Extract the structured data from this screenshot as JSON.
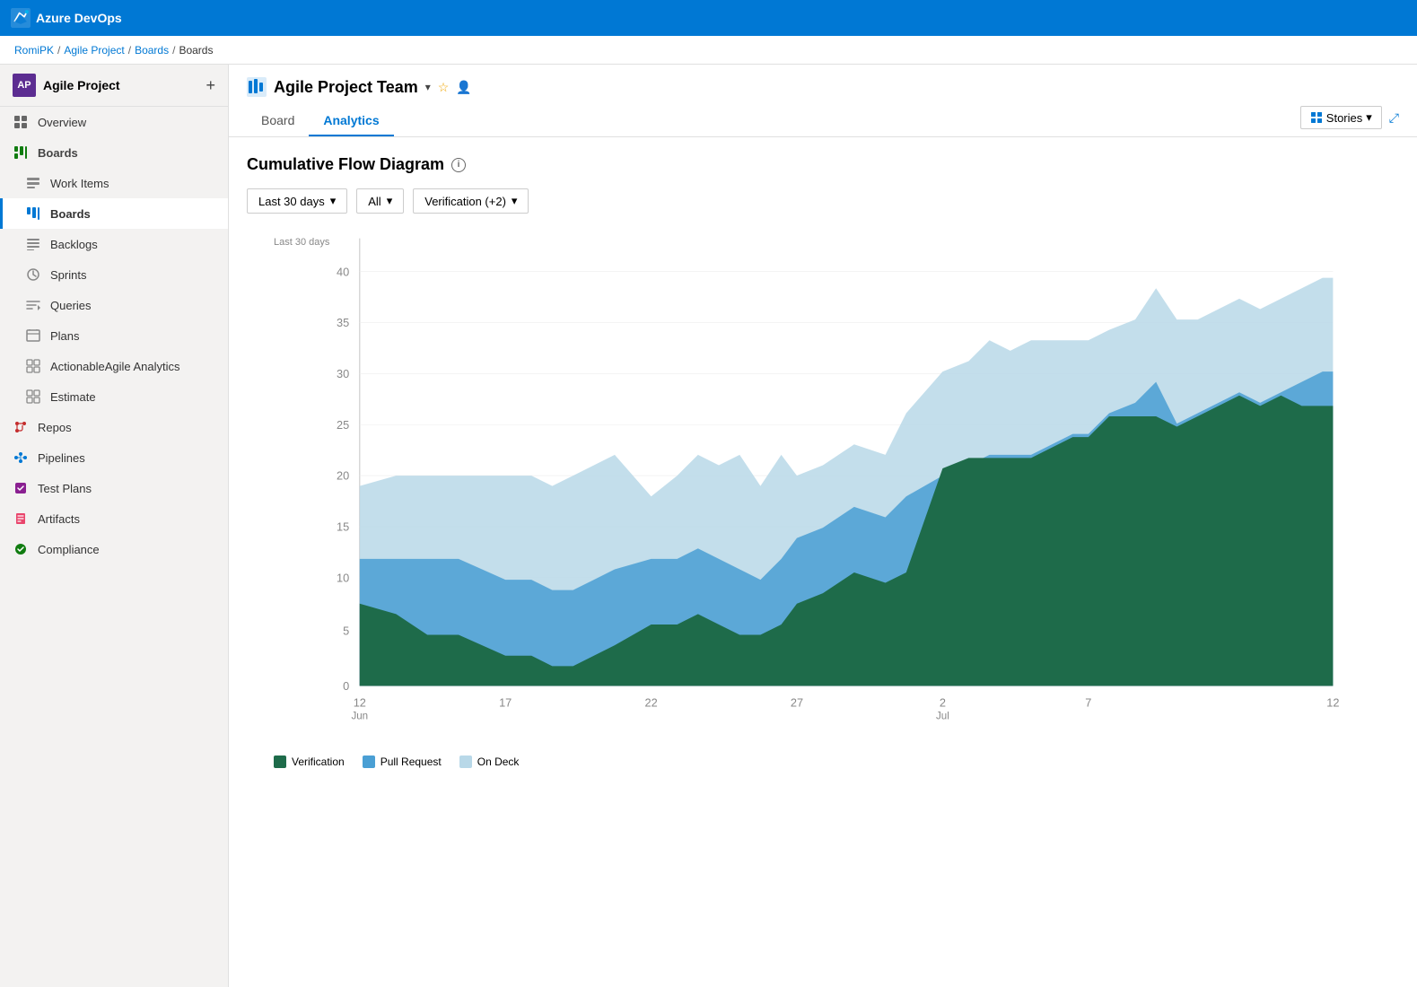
{
  "app": {
    "title": "Azure DevOps",
    "logo_color": "#0078d4"
  },
  "breadcrumb": {
    "items": [
      "RomiPK",
      "Agile Project",
      "Boards",
      "Boards"
    ]
  },
  "sidebar": {
    "project_name": "Agile Project",
    "avatar_text": "AP",
    "nav_items": [
      {
        "id": "overview",
        "label": "Overview",
        "icon": "overview"
      },
      {
        "id": "boards",
        "label": "Boards",
        "icon": "boards",
        "section": true
      },
      {
        "id": "work-items",
        "label": "Work Items",
        "icon": "work-items"
      },
      {
        "id": "boards2",
        "label": "Boards",
        "icon": "boards2",
        "active": true
      },
      {
        "id": "backlogs",
        "label": "Backlogs",
        "icon": "backlogs"
      },
      {
        "id": "sprints",
        "label": "Sprints",
        "icon": "sprints"
      },
      {
        "id": "queries",
        "label": "Queries",
        "icon": "queries"
      },
      {
        "id": "plans",
        "label": "Plans",
        "icon": "plans"
      },
      {
        "id": "actionable",
        "label": "ActionableAgile Analytics",
        "icon": "analytics"
      },
      {
        "id": "estimate",
        "label": "Estimate",
        "icon": "estimate"
      },
      {
        "id": "repos",
        "label": "Repos",
        "icon": "repos"
      },
      {
        "id": "pipelines",
        "label": "Pipelines",
        "icon": "pipelines"
      },
      {
        "id": "test-plans",
        "label": "Test Plans",
        "icon": "test-plans"
      },
      {
        "id": "artifacts",
        "label": "Artifacts",
        "icon": "artifacts"
      },
      {
        "id": "compliance",
        "label": "Compliance",
        "icon": "compliance"
      }
    ]
  },
  "content": {
    "team_title": "Agile Project Team",
    "tabs": [
      {
        "id": "board",
        "label": "Board",
        "active": false
      },
      {
        "id": "analytics",
        "label": "Analytics",
        "active": true
      }
    ],
    "toolbar": {
      "stories_label": "Stories",
      "expand_label": "⤢"
    },
    "chart": {
      "title": "Cumulative Flow Diagram",
      "label_period": "Last 30 days",
      "filters": [
        {
          "id": "period",
          "value": "Last 30 days"
        },
        {
          "id": "type",
          "value": "All"
        },
        {
          "id": "stages",
          "value": "Verification (+2)"
        }
      ],
      "x_labels": [
        "12\nJun",
        "17",
        "22",
        "27",
        "2\nJul",
        "7",
        "12"
      ],
      "y_labels": [
        "0",
        "5",
        "10",
        "15",
        "20",
        "25",
        "30",
        "35",
        "40"
      ],
      "series": [
        {
          "id": "verification",
          "label": "Verification",
          "color": "#1e6b4a"
        },
        {
          "id": "pull-request",
          "label": "Pull Request",
          "color": "#4a9fd4"
        },
        {
          "id": "on-deck",
          "label": "On Deck",
          "color": "#b8d8e8"
        }
      ]
    }
  }
}
